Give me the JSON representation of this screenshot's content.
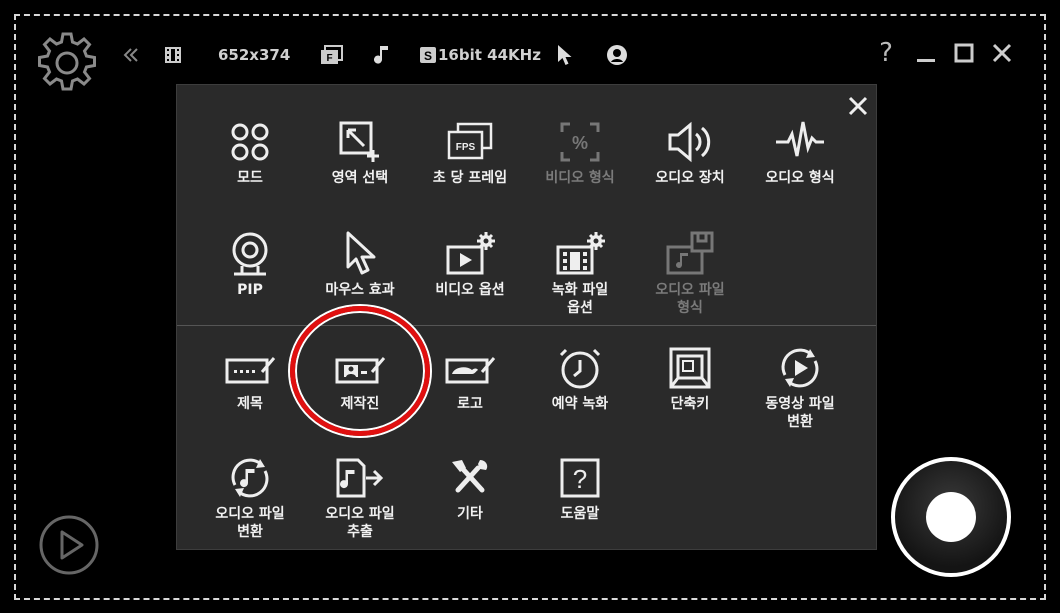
{
  "toolbar": {
    "resolution": "652x374",
    "audio_format": "16bit 44KHz",
    "help_label": "?"
  },
  "menu": {
    "row1": [
      {
        "icon": "mode-icon",
        "label": "모드",
        "enabled": true
      },
      {
        "icon": "area-select-icon",
        "label": "영역 선택",
        "enabled": true
      },
      {
        "icon": "fps-icon",
        "label": "초 당 프레임",
        "enabled": true
      },
      {
        "icon": "video-format-icon",
        "label": "비디오 형식",
        "enabled": false
      },
      {
        "icon": "speaker-icon",
        "label": "오디오 장치",
        "enabled": true
      },
      {
        "icon": "waveform-icon",
        "label": "오디오 형식",
        "enabled": true
      }
    ],
    "row2": [
      {
        "icon": "webcam-icon",
        "label": "PIP",
        "enabled": true
      },
      {
        "icon": "cursor-icon",
        "label": "마우스 효과",
        "enabled": true
      },
      {
        "icon": "video-options-icon",
        "label": "비디오 옵션",
        "enabled": true
      },
      {
        "icon": "record-file-options-icon",
        "label": "녹화 파일\n옵션",
        "enabled": true
      },
      {
        "icon": "audio-file-format-icon",
        "label": "오디오 파일\n형식",
        "enabled": false
      }
    ],
    "row3": [
      {
        "icon": "title-icon",
        "label": "제목",
        "enabled": true
      },
      {
        "icon": "credits-icon",
        "label": "제작진",
        "enabled": true
      },
      {
        "icon": "logo-icon",
        "label": "로고",
        "enabled": true
      },
      {
        "icon": "clock-icon",
        "label": "예약 녹화",
        "enabled": true
      },
      {
        "icon": "hotkey-icon",
        "label": "단축키",
        "enabled": true
      },
      {
        "icon": "video-convert-icon",
        "label": "동영상 파일\n변환",
        "enabled": true
      }
    ],
    "row4": [
      {
        "icon": "audio-convert-icon",
        "label": "오디오 파일\n변환",
        "enabled": true
      },
      {
        "icon": "audio-extract-icon",
        "label": "오디오 파일\n추출",
        "enabled": true
      },
      {
        "icon": "tools-icon",
        "label": "기타",
        "enabled": true
      },
      {
        "icon": "help-icon",
        "label": "도움말",
        "enabled": true
      }
    ]
  }
}
